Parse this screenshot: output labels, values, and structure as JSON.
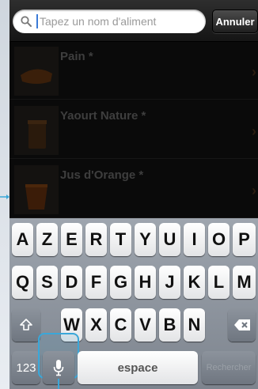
{
  "search": {
    "placeholder": "Tapez un nom d'aliment",
    "cancel_label": "Annuler"
  },
  "food_list": [
    {
      "name": "Pain *"
    },
    {
      "name": "Yaourt Nature *"
    },
    {
      "name": "Jus d'Orange *"
    }
  ],
  "keyboard": {
    "row1": [
      "A",
      "Z",
      "E",
      "R",
      "T",
      "Y",
      "U",
      "I",
      "O",
      "P"
    ],
    "row2": [
      "Q",
      "S",
      "D",
      "F",
      "G",
      "H",
      "J",
      "K",
      "L",
      "M"
    ],
    "row3": [
      "W",
      "X",
      "C",
      "V",
      "B",
      "N"
    ],
    "shift_icon": "shift-arrow-icon",
    "delete_icon": "delete-backspace-icon",
    "numbers_label": "123",
    "mic_icon": "microphone-icon",
    "space_label": "espace",
    "search_label": "Rechercher"
  },
  "colors": {
    "highlight": "#3aa7d9",
    "caret": "#3b7bd8"
  }
}
